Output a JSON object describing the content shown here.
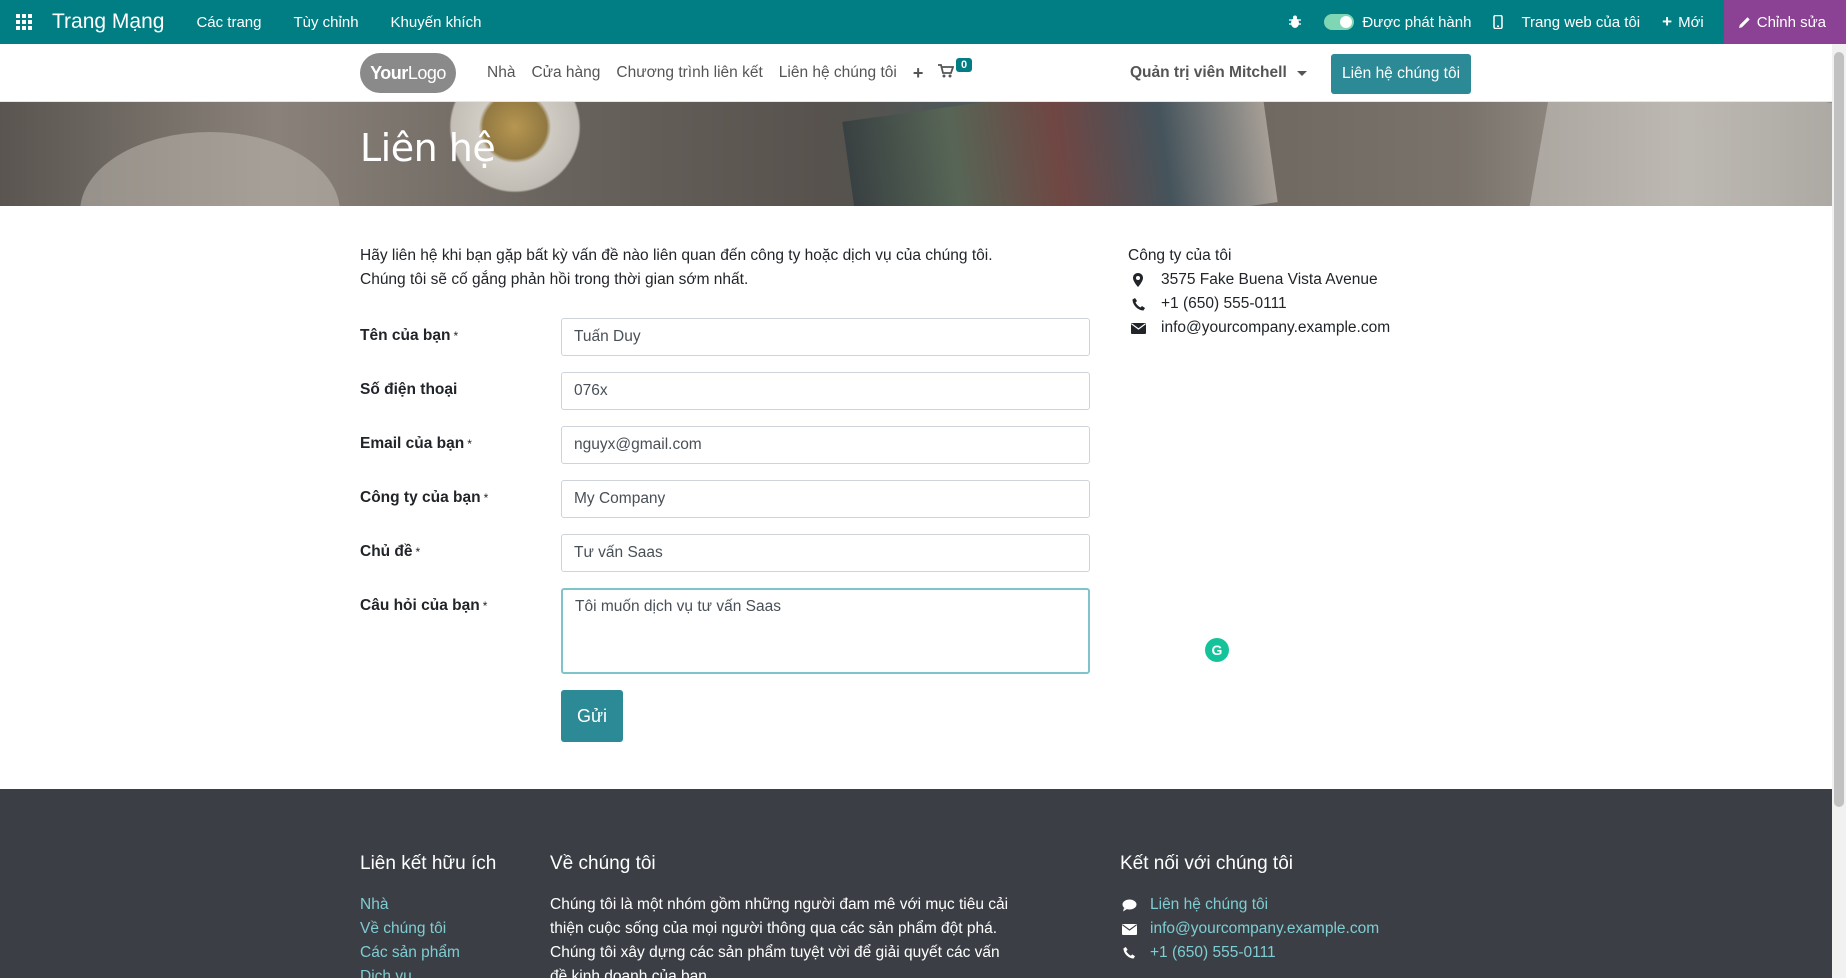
{
  "topbar": {
    "brand": "Trang Mạng",
    "menu": [
      "Các trang",
      "Tùy chỉnh",
      "Khuyến khích"
    ],
    "published_label": "Được phát hành",
    "my_website_label": "Trang web của tôi",
    "new_label": "Mới",
    "edit_label": "Chỉnh sửa"
  },
  "navbar": {
    "logo_bold": "Your",
    "logo_light": "Logo",
    "links": [
      "Nhà",
      "Cửa hàng",
      "Chương trình liên kết",
      "Liên hệ chúng tôi"
    ],
    "cart_count": "0",
    "user": "Quản trị viên Mitchell",
    "contact_button": "Liên hệ chúng tôi"
  },
  "hero": {
    "title": "Liên hệ"
  },
  "intro": {
    "line1": "Hãy liên hệ khi bạn gặp bất kỳ vấn đề nào liên quan đến công ty hoặc dịch vụ của chúng tôi.",
    "line2": "Chúng tôi sẽ cố gắng phản hồi trong thời gian sớm nhất."
  },
  "form": {
    "name": {
      "label": "Tên của bạn",
      "required": "*",
      "value": "Tuấn Duy"
    },
    "phone": {
      "label": "Số điện thoại",
      "value": "076x"
    },
    "email": {
      "label": "Email của bạn",
      "required": "*",
      "value": "nguyx@gmail.com"
    },
    "company": {
      "label": "Công ty của bạn",
      "required": "*",
      "value": "My Company"
    },
    "subject": {
      "label": "Chủ đề",
      "required": "*",
      "value": "Tư vấn Saas"
    },
    "question": {
      "label": "Câu hỏi của bạn",
      "required": "*",
      "value": "Tôi muốn dịch vụ tư vấn Saas"
    },
    "submit": "Gửi"
  },
  "company_info": {
    "name": "Công ty của tôi",
    "address": "3575 Fake Buena Vista Avenue",
    "phone": "+1 (650) 555-0111",
    "email": "info@yourcompany.example.com"
  },
  "footer": {
    "links_title": "Liên kết hữu ích",
    "links": [
      "Nhà",
      "Về chúng tôi",
      "Các sản phẩm",
      "Dịch vụ"
    ],
    "about_title": "Về chúng tôi",
    "about_text": "Chúng tôi là một nhóm gồm những người đam mê với mục tiêu cải thiện cuộc sống của mọi người thông qua các sản phẩm đột phá. Chúng tôi xây dựng các sản phẩm tuyệt vời để giải quyết các vấn đề kinh doanh của bạn.",
    "connect_title": "Kết nối với chúng tôi",
    "connect_contact": "Liên hệ chúng tôi",
    "connect_email": "info@yourcompany.example.com",
    "connect_phone": "+1 (650) 555-0111"
  },
  "colors": {
    "topbar": "#017e84",
    "primary_button": "#2b8a95",
    "edit": "#8b4294",
    "footer": "#3b3f45",
    "footer_link": "#7ecdd3"
  },
  "icons": [
    "apps-icon",
    "bug-icon",
    "mobile-icon",
    "plus-icon",
    "pencil-icon",
    "cart-icon",
    "map-marker-icon",
    "phone-icon",
    "envelope-icon",
    "comment-icon"
  ]
}
